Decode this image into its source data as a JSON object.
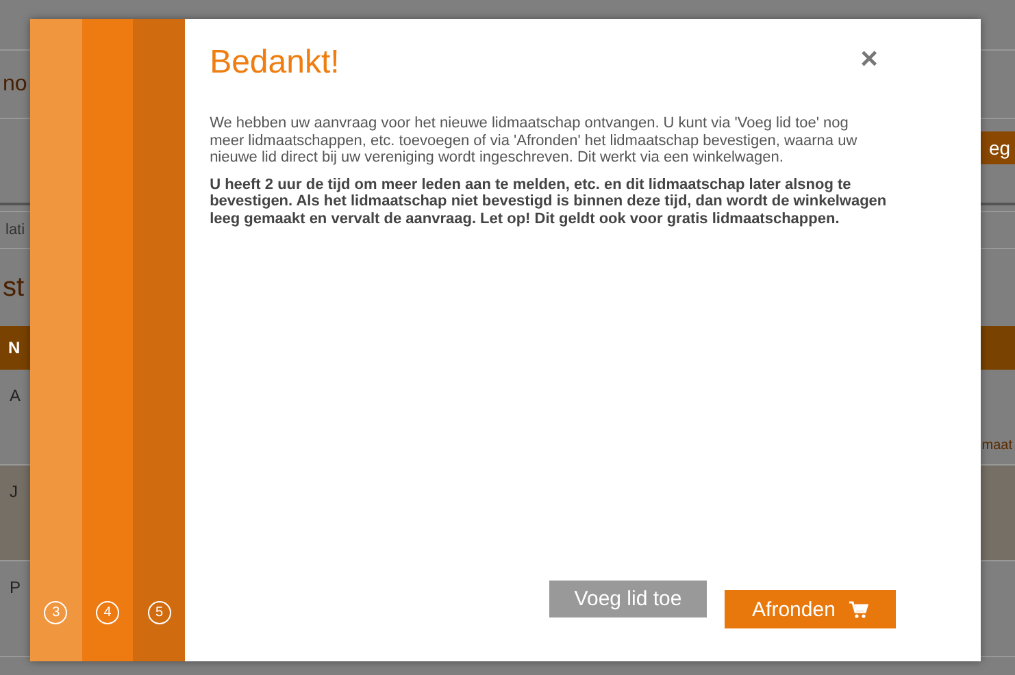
{
  "background_page": {
    "heading": "no",
    "button": "eg",
    "tab": "lati",
    "section_title": "st",
    "table": {
      "header": "N",
      "rows": [
        {
          "cell": "A",
          "link": "maat",
          "selected": false
        },
        {
          "cell": "J",
          "selected": true
        },
        {
          "cell": "P",
          "selected": false
        }
      ]
    }
  },
  "dialog": {
    "steps": [
      {
        "label": "3",
        "color": "#f0963f"
      },
      {
        "label": "4",
        "color": "#ee7a12"
      },
      {
        "label": "5",
        "color": "#d16b10"
      }
    ],
    "title": "Bedankt!",
    "close": "×",
    "paragraphs": [
      {
        "text": "We hebben uw aanvraag voor het nieuwe lidmaatschap ontvangen. U kunt via 'Voeg lid toe' nog meer lidmaatschappen, etc. toevoegen of via 'Afronden' het lidmaatschap bevestigen, waarna uw nieuwe lid direct bij uw vereniging wordt ingeschreven. Dit werkt via een winkelwagen.",
        "bold": false
      },
      {
        "text": "U heeft 2 uur de tijd om meer leden aan te melden, etc. en dit lidmaatschap later alsnog te bevestigen. Als het lidmaatschap niet bevestigd is binnen deze tijd, dan wordt de winkelwagen leeg gemaakt en vervalt de aanvraag. Let op! Dit geldt ook voor gratis lidmaatschappen.",
        "bold": true
      }
    ],
    "buttons": [
      {
        "label": "Voeg lid toe",
        "kind": "secondary"
      },
      {
        "label": "Afronden",
        "kind": "primary"
      }
    ]
  }
}
